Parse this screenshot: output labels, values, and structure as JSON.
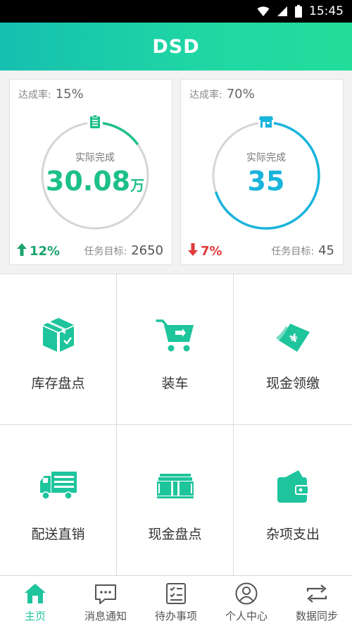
{
  "status_bar": {
    "time": "15:45"
  },
  "header": {
    "title": "DSD"
  },
  "cards": [
    {
      "rate_label": "达成率:",
      "rate_value": "15%",
      "caption": "实际完成",
      "value": "30.08",
      "unit": "万",
      "progress": 0.15,
      "change": "12%",
      "change_direction": "up",
      "target_label": "任务目标:",
      "target_value": "2650",
      "icon": "clipboard-icon",
      "color": "#1dbf8a"
    },
    {
      "rate_label": "达成率:",
      "rate_value": "70%",
      "caption": "实际完成",
      "value": "35",
      "unit": "",
      "progress": 0.7,
      "change": "7%",
      "change_direction": "down",
      "target_label": "任务目标:",
      "target_value": "45",
      "icon": "store-icon",
      "color": "#19b4dc"
    }
  ],
  "grid": [
    {
      "label": "库存盘点",
      "icon": "inventory-box-icon"
    },
    {
      "label": "装车",
      "icon": "shopping-cart-icon"
    },
    {
      "label": "现金领缴",
      "icon": "cash-note-icon"
    },
    {
      "label": "配送直销",
      "icon": "delivery-truck-icon"
    },
    {
      "label": "现金盘点",
      "icon": "money-stack-icon"
    },
    {
      "label": "杂项支出",
      "icon": "wallet-icon"
    }
  ],
  "tabs": [
    {
      "label": "主页",
      "icon": "home-icon",
      "active": true
    },
    {
      "label": "消息通知",
      "icon": "message-icon",
      "active": false
    },
    {
      "label": "待办事项",
      "icon": "todo-list-icon",
      "active": false
    },
    {
      "label": "个人中心",
      "icon": "user-icon",
      "active": false
    },
    {
      "label": "数据同步",
      "icon": "sync-icon",
      "active": false
    }
  ],
  "colors": {
    "accent": "#1dc49c",
    "up": "#1ca36f",
    "down": "#e03b3b",
    "ring_track": "#d5d5d5"
  }
}
